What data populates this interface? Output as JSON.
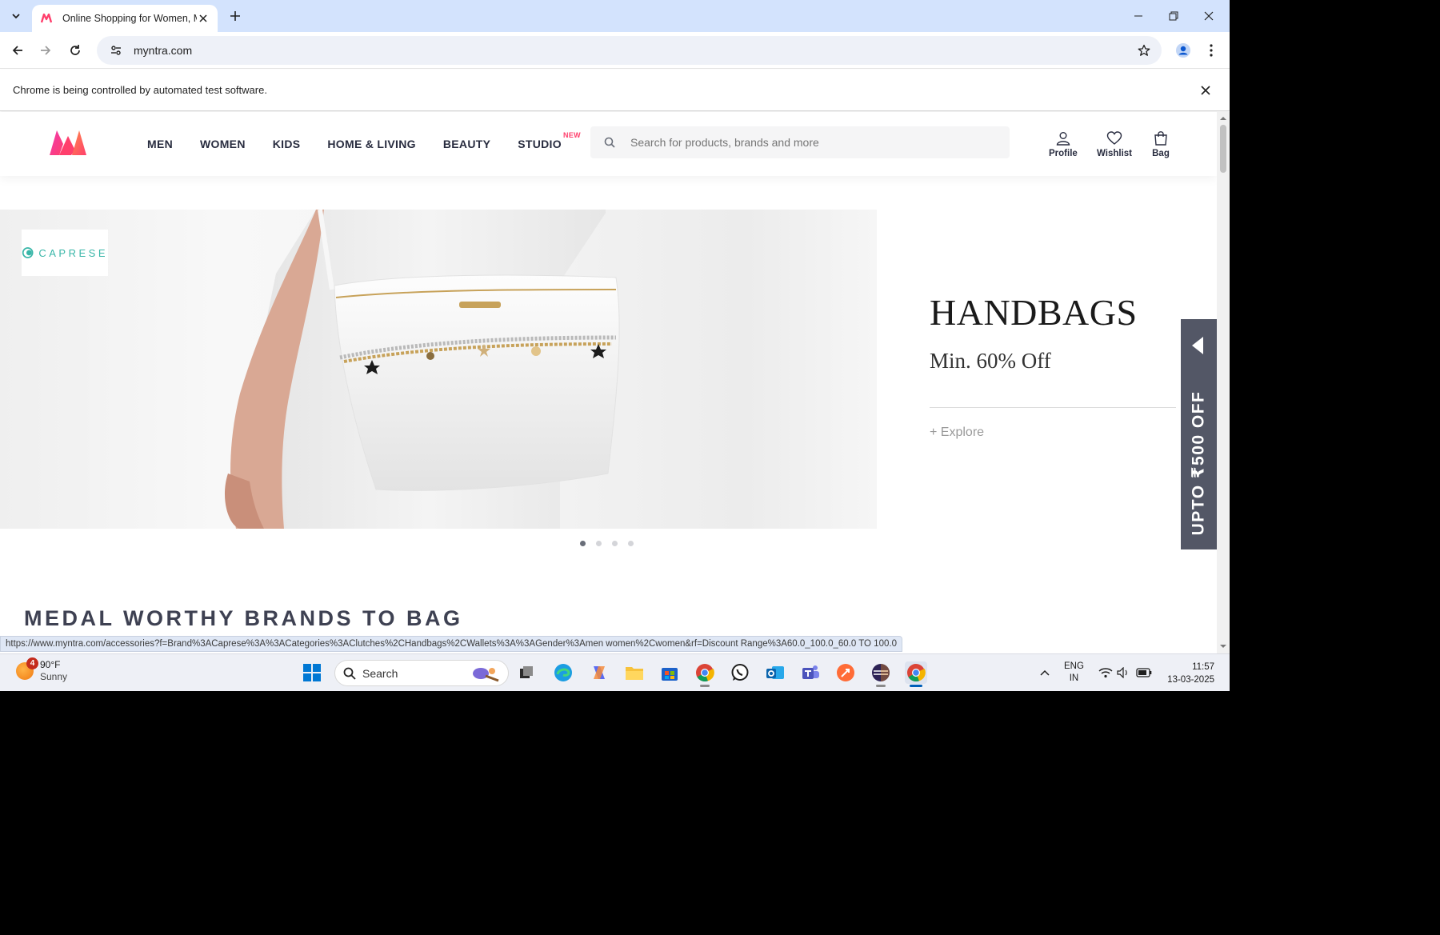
{
  "browser": {
    "tab_title": "Online Shopping for Women, Men, Kids",
    "url": "myntra.com",
    "infobar_message": "Chrome is being controlled by automated test software.",
    "status_url": "https://www.myntra.com/accessories?f=Brand%3ACaprese%3A%3ACategories%3AClutches%2CHandbags%2CWallets%3A%3AGender%3Amen women%2Cwomen&rf=Discount Range%3A60.0_100.0_60.0 TO 100.0"
  },
  "header": {
    "nav": [
      {
        "label": "MEN"
      },
      {
        "label": "WOMEN"
      },
      {
        "label": "KIDS"
      },
      {
        "label": "HOME & LIVING"
      },
      {
        "label": "BEAUTY"
      },
      {
        "label": "STUDIO",
        "badge": "NEW"
      }
    ],
    "search_placeholder": "Search for products, brands and more",
    "actions": {
      "profile": "Profile",
      "wishlist": "Wishlist",
      "bag": "Bag"
    }
  },
  "banner": {
    "brand": "CAPRESE",
    "title": "HANDBAGS",
    "subtitle": "Min. 60% Off",
    "cta": "+ Explore",
    "slides": 4,
    "active_slide": 1
  },
  "side_promo": "UPTO ₹500 OFF",
  "section_title": "MEDAL WORTHY BRANDS TO BAG",
  "taskbar": {
    "weather_temp": "90°F",
    "weather_cond": "Sunny",
    "weather_badge": "4",
    "search_label": "Search",
    "lang_line1": "ENG",
    "lang_line2": "IN",
    "time": "11:57",
    "date": "13-03-2025"
  },
  "colors": {
    "brand_pink": "#ff3f6c",
    "brand_orange": "#f16565",
    "nav_text": "#282c3f",
    "promo_bg": "#535766",
    "tab_strip": "#d3e3fd"
  }
}
